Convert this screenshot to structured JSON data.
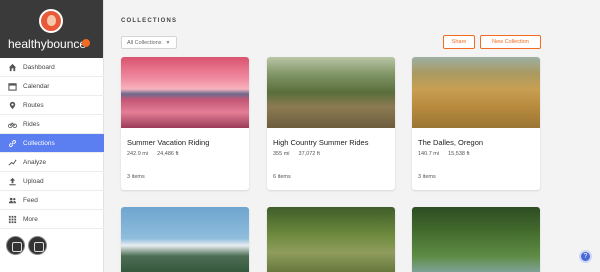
{
  "sidebar": {
    "username": "healthybounce",
    "badge": "●",
    "nav": [
      {
        "label": "Dashboard",
        "icon": "home-icon"
      },
      {
        "label": "Calendar",
        "icon": "calendar-icon"
      },
      {
        "label": "Routes",
        "icon": "location-pin-icon"
      },
      {
        "label": "Rides",
        "icon": "bike-icon"
      },
      {
        "label": "Collections",
        "icon": "link-icon",
        "active": true
      },
      {
        "label": "Analyze",
        "icon": "trend-line-icon"
      },
      {
        "label": "Upload",
        "icon": "upload-icon"
      },
      {
        "label": "Feed",
        "icon": "people-icon"
      },
      {
        "label": "More",
        "icon": "grid-icon"
      }
    ]
  },
  "header": {
    "title": "COLLECTIONS",
    "filter_label": "All Collections",
    "share_label": "Share",
    "new_collection_label": "New Collection"
  },
  "collections": [
    {
      "name": "Summer Vacation Riding",
      "distance": "242.9 mi",
      "elevation": "24,486 ft",
      "items": "3 items"
    },
    {
      "name": "High Country Summer Rides",
      "distance": "355 mi",
      "elevation": "37,072 ft",
      "items": "6 items"
    },
    {
      "name": "The Dalles, Oregon",
      "distance": "140.7 mi",
      "elevation": "15,538 ft",
      "items": "3 items"
    }
  ],
  "help": {
    "label": "?"
  },
  "colors": {
    "accent": "#f26b21",
    "active_nav": "#5b7ef0"
  }
}
